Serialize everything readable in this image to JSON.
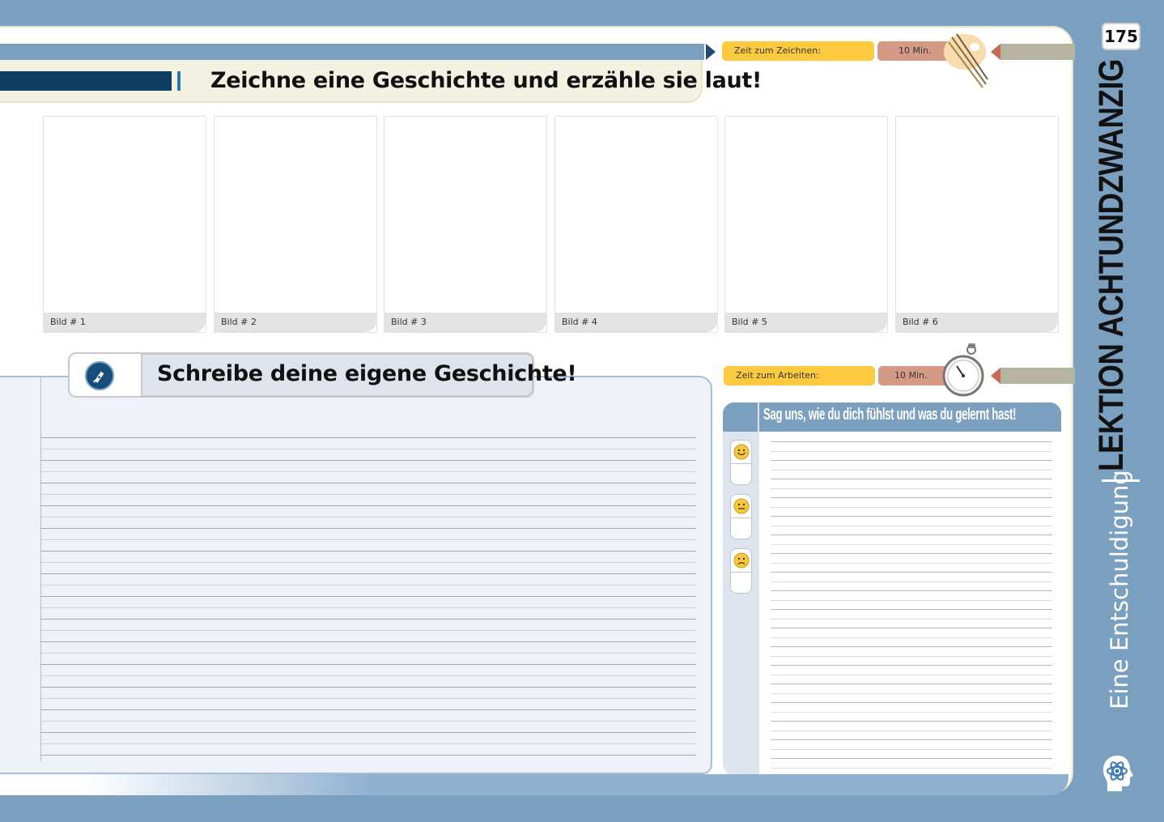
{
  "page_number": "175",
  "sidebar": {
    "lesson_title": "LEKTION ACHTUNDZWANZIG",
    "lesson_subtitle": "Eine Entschuldigung",
    "logo_icon": "atom-head-icon"
  },
  "drawing_section": {
    "title": "Zeichne eine Geschichte und erzähle sie laut!",
    "timer_label": "Zeit zum Zeichnen:",
    "timer_value": "10 Min.",
    "timer_icon": "paintbrush-palette-icon",
    "panels": [
      {
        "label": "Bild # 1"
      },
      {
        "label": "Bild # 2"
      },
      {
        "label": "Bild # 3"
      },
      {
        "label": "Bild # 4"
      },
      {
        "label": "Bild # 5"
      },
      {
        "label": "Bild # 6"
      }
    ]
  },
  "writing_section": {
    "title": "Schreibe deine eigene Geschichte!",
    "icon": "fountain-pen-icon"
  },
  "feedback_section": {
    "timer_label": "Zeit zum Arbeiten:",
    "timer_value": "10 Min.",
    "timer_icon": "stopwatch-icon",
    "title": "Sag uns, wie du dich fühlst und was du gelernt hast!",
    "moods": [
      "happy-face-icon",
      "neutral-face-icon",
      "sad-face-icon"
    ]
  },
  "colors": {
    "background": "#7a9fbf",
    "dark_blue": "#0e3d64",
    "timer_yellow": "#fcc93f",
    "timer_red": "#d59a85"
  }
}
